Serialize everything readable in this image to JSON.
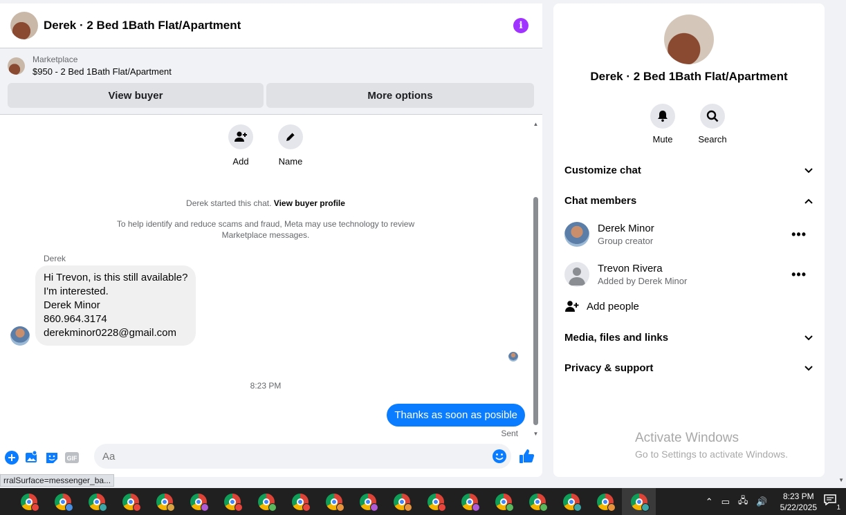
{
  "chat": {
    "title": "Derek · 2 Bed 1Bath Flat/Apartment",
    "marketplace_label": "Marketplace",
    "listing": "$950 - 2 Bed 1Bath Flat/Apartment",
    "view_buyer": "View buyer",
    "more_options": "More options",
    "actions": {
      "add": "Add",
      "name": "Name"
    },
    "started_prefix": "Derek started this chat.",
    "started_link": "View buyer profile",
    "notice": "To help identify and reduce scams and fraud, Meta may use technology to review Marketplace messages.",
    "sender": "Derek",
    "incoming_lines": [
      "Hi Trevon, is this still available?",
      "I'm interested.",
      "Derek Minor",
      "860.964.3174",
      "derekminor0228@gmail.com"
    ],
    "time_separator": "8:23 PM",
    "outgoing": "Thanks as soon as posible",
    "sent_status": "Sent",
    "input_placeholder": "Aa",
    "gif_label": "GIF"
  },
  "details": {
    "title": "Derek · 2 Bed 1Bath Flat/Apartment",
    "mute": "Mute",
    "search": "Search",
    "customize_chat": "Customize chat",
    "chat_members": "Chat members",
    "members": [
      {
        "name": "Derek Minor",
        "role": "Group creator"
      },
      {
        "name": "Trevon Rivera",
        "role": "Added by Derek Minor"
      }
    ],
    "add_people": "Add people",
    "media": "Media, files and links",
    "privacy": "Privacy & support"
  },
  "watermark": {
    "title": "Activate Windows",
    "subtitle": "Go to Settings to activate Windows."
  },
  "status_url": "rralSurface=messenger_ba...",
  "taskbar": {
    "time": "8:23 PM",
    "date": "5/22/2025",
    "notification_count": "1",
    "app_badges": [
      "#e8453c",
      "#4a90e2",
      "#3ea6a6",
      "#e8453c",
      "#d9a441",
      "#b05cd6",
      "#e8453c",
      "#5cb85c",
      "#e8453c",
      "#e8943c",
      "#b05cd6",
      "#e8943c",
      "#e8453c",
      "#b05cd6",
      "#5cb85c",
      "#5cb85c",
      "#3ea6a6",
      "#e8943c",
      "#3ea6a6"
    ]
  },
  "colors": {
    "accent": "#0a7cff",
    "info": "#a033ff"
  }
}
